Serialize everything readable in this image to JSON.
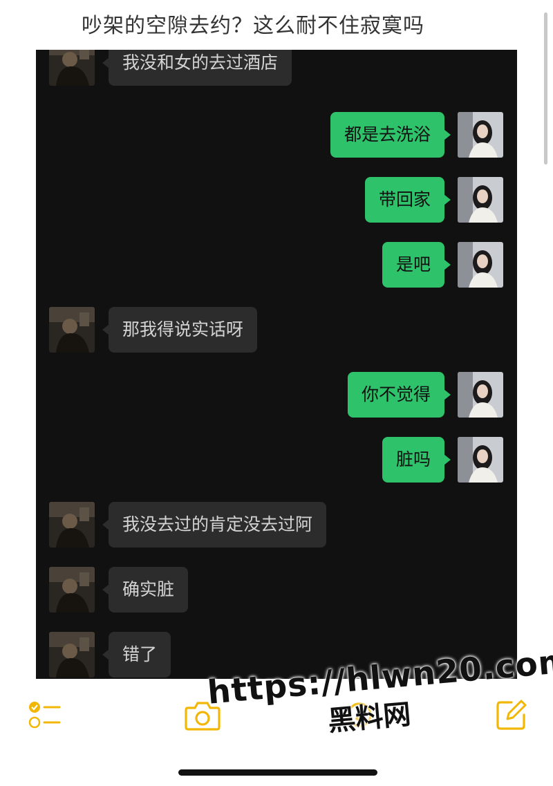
{
  "note": {
    "title": "吵架的空隙去约？这么耐不住寂寞吗"
  },
  "chat": {
    "messages": [
      {
        "side": "left",
        "text": "我没和女的去过酒店"
      },
      {
        "side": "right",
        "text": "都是去洗浴"
      },
      {
        "side": "right",
        "text": "带回家"
      },
      {
        "side": "right",
        "text": "是吧"
      },
      {
        "side": "left",
        "text": "那我得说实话呀"
      },
      {
        "side": "right",
        "text": "你不觉得"
      },
      {
        "side": "right",
        "text": "脏吗"
      },
      {
        "side": "left",
        "text": "我没去过的肯定没去过阿"
      },
      {
        "side": "left",
        "text": "确实脏"
      },
      {
        "side": "left",
        "text": "错了"
      }
    ]
  },
  "toolbar": {
    "icons": [
      "checklist-icon",
      "camera-icon",
      "pen-icon",
      "compose-icon"
    ],
    "accent_color": "#f2b705"
  },
  "watermark": {
    "url": "https://hlwn20.com",
    "name": "黑料网"
  }
}
